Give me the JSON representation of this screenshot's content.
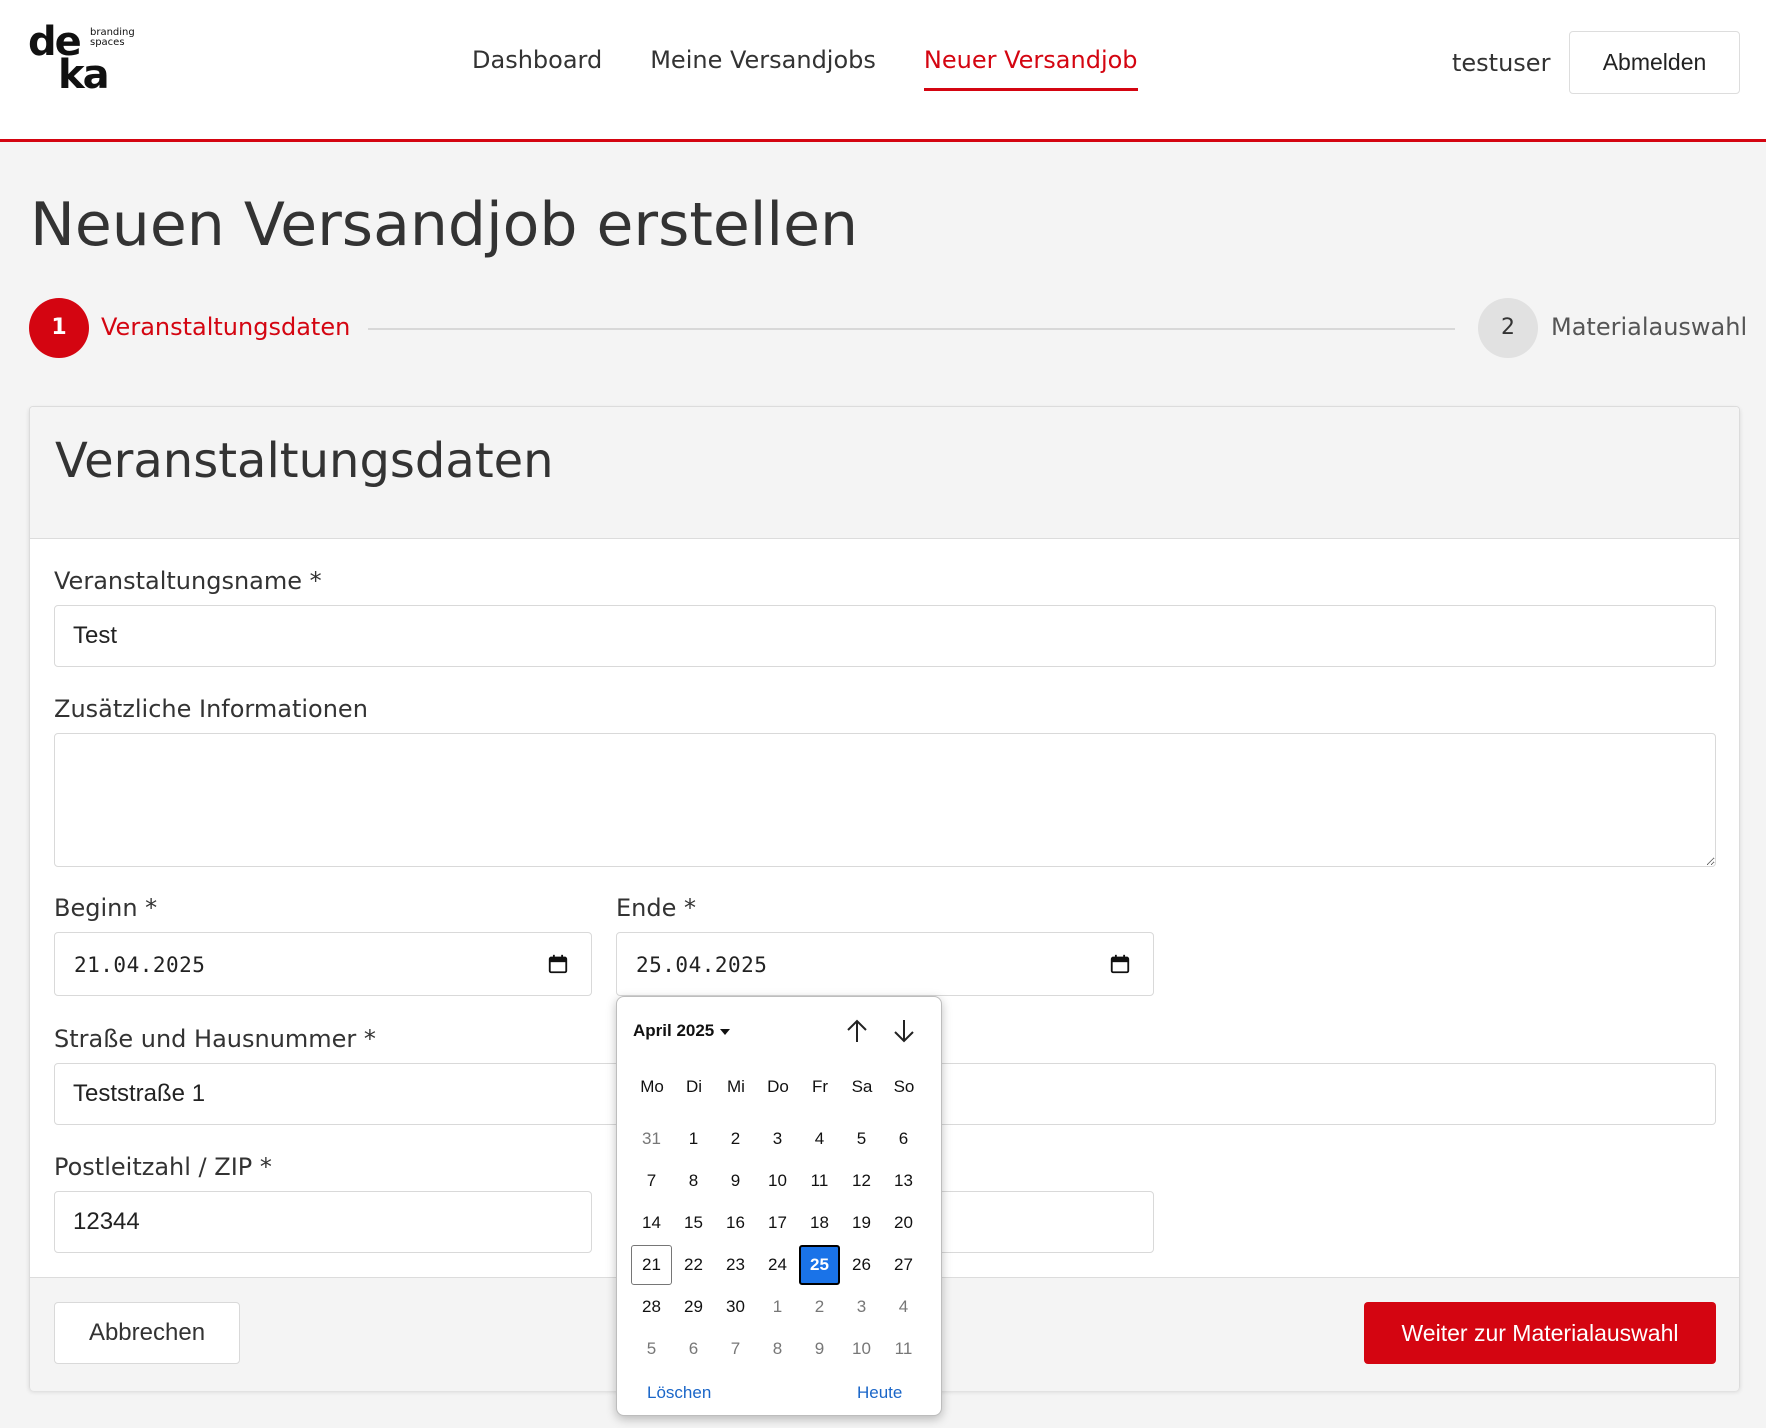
{
  "brand": {
    "logo_line1": "de",
    "logo_line2": "ka",
    "logo_sub1": "branding",
    "logo_sub2": "spaces"
  },
  "nav": {
    "items": [
      {
        "label": "Dashboard",
        "active": false
      },
      {
        "label": "Meine Versandjobs",
        "active": false
      },
      {
        "label": "Neuer Versandjob",
        "active": true
      }
    ]
  },
  "user": {
    "name": "testuser",
    "logout_label": "Abmelden"
  },
  "page": {
    "title": "Neuen Versandjob erstellen"
  },
  "stepper": {
    "steps": [
      {
        "number": "1",
        "label": "Veranstaltungsdaten",
        "active": true
      },
      {
        "number": "2",
        "label": "Materialauswahl",
        "active": false
      }
    ]
  },
  "form": {
    "title": "Veranstaltungsdaten",
    "event_name": {
      "label": "Veranstaltungsname *",
      "value": "Test"
    },
    "info": {
      "label": "Zusätzliche Informationen",
      "value": ""
    },
    "begin": {
      "label": "Beginn *",
      "value": "21.04.2025"
    },
    "end": {
      "label": "Ende *",
      "value": "25.04.2025"
    },
    "street": {
      "label": "Straße und Hausnummer *",
      "value": "Teststraße 1"
    },
    "zip": {
      "label": "Postleitzahl / ZIP *",
      "value": "12344"
    },
    "city": {
      "value": ""
    },
    "cancel_label": "Abbrechen",
    "next_label": "Weiter zur Materialauswahl"
  },
  "datepicker": {
    "month_label": "April 2025",
    "weekdays": [
      "Mo",
      "Di",
      "Mi",
      "Do",
      "Fr",
      "Sa",
      "So"
    ],
    "weeks": [
      [
        "31",
        "1",
        "2",
        "3",
        "4",
        "5",
        "6"
      ],
      [
        "7",
        "8",
        "9",
        "10",
        "11",
        "12",
        "13"
      ],
      [
        "14",
        "15",
        "16",
        "17",
        "18",
        "19",
        "20"
      ],
      [
        "21",
        "22",
        "23",
        "24",
        "25",
        "26",
        "27"
      ],
      [
        "28",
        "29",
        "30",
        "1",
        "2",
        "3",
        "4"
      ],
      [
        "5",
        "6",
        "7",
        "8",
        "9",
        "10",
        "11"
      ]
    ],
    "other_month_cells": [
      [
        0,
        0
      ],
      [
        4,
        3
      ],
      [
        4,
        4
      ],
      [
        4,
        5
      ],
      [
        4,
        6
      ],
      [
        5,
        0
      ],
      [
        5,
        1
      ],
      [
        5,
        2
      ],
      [
        5,
        3
      ],
      [
        5,
        4
      ],
      [
        5,
        5
      ],
      [
        5,
        6
      ]
    ],
    "today_cell": [
      3,
      0
    ],
    "selected_cell": [
      3,
      4
    ],
    "clear_label": "Löschen",
    "today_label": "Heute",
    "accent_color": "#1a73e8"
  },
  "colors": {
    "brand_red": "#d40511",
    "background": "#f4f4f4"
  },
  "icons": {
    "date_picker": "calendar-icon",
    "previous_month": "arrow-up-icon",
    "next_month": "arrow-down-icon"
  }
}
